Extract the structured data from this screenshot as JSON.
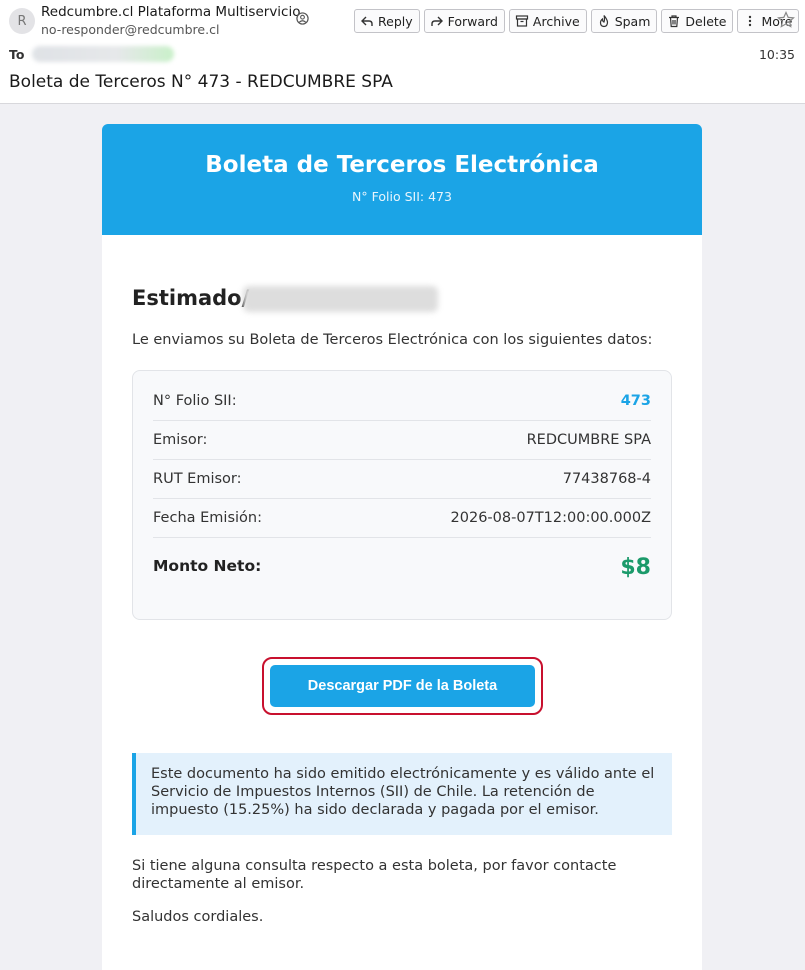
{
  "header": {
    "avatar_letter": "R",
    "sender_name": "Redcumbre.cl Plataforma Multiservicio",
    "sender_email": "no-responder@redcumbre.cl",
    "to_label": "To",
    "time": "10:35",
    "subject": "Boleta de Terceros N° 473 - REDCUMBRE SPA"
  },
  "toolbar": {
    "reply": "Reply",
    "forward": "Forward",
    "archive": "Archive",
    "spam": "Spam",
    "delete": "Delete",
    "more": "More"
  },
  "email": {
    "banner_title": "Boleta de Terceros Electrónica",
    "banner_folio": "N° Folio SII: 473",
    "greeting": "Estimado/",
    "intro": "Le enviamos su Boleta de Terceros Electrónica con los siguientes datos:",
    "details": {
      "folio_label": "N° Folio SII:",
      "folio_value": "473",
      "emisor_label": "Emisor:",
      "emisor_value": "REDCUMBRE SPA",
      "rut_label": "RUT Emisor:",
      "rut_value": "77438768-4",
      "fecha_label": "Fecha Emisión:",
      "fecha_value": "2026-08-07T12:00:00.000Z",
      "monto_label": "Monto Neto:",
      "monto_value": "$8"
    },
    "download_button": "Descargar PDF de la Boleta",
    "notice": "Este documento ha sido emitido electrónicamente y es válido ante el Servicio de Impuestos Internos (SII) de Chile. La retención de impuesto (15.25%) ha sido declarada y pagada por el emisor.",
    "contact_text": "Si tiene alguna consulta respecto a esta boleta, por favor contacte directamente al emisor.",
    "closing": "Saludos cordiales."
  },
  "colors": {
    "accent": "#1ba4e6",
    "amount_green": "#1b9a6a",
    "highlight_red": "#c8102e"
  }
}
